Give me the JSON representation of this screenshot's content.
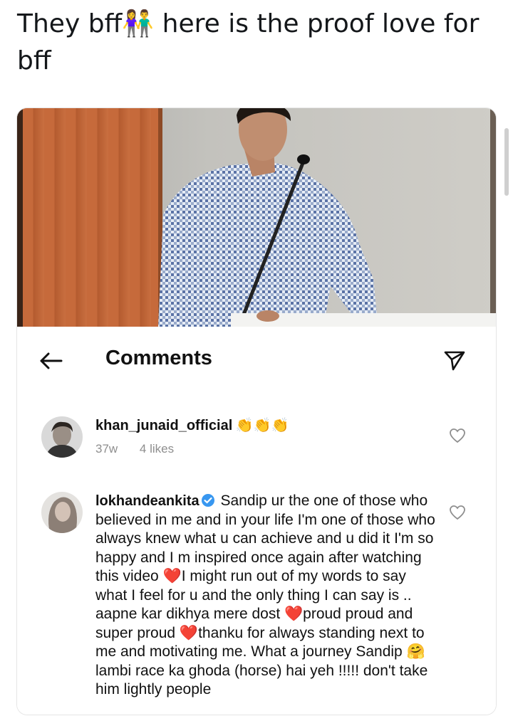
{
  "tweet": {
    "text_before": "They bff",
    "emoji": "👫",
    "text_after": " here is the proof love for bff"
  },
  "photo": {
    "description_colors": {
      "door": "#c66a3b",
      "wall": "#cfcdc7",
      "shirt": "#7d8fb3"
    }
  },
  "comments_header": {
    "title": "Comments",
    "back_icon": "arrow-left-icon",
    "share_icon": "paper-plane-icon"
  },
  "comments": [
    {
      "username": "khan_junaid_official",
      "emojis": "👏👏👏",
      "age": "37w",
      "likes": "4 likes",
      "icon": "heart-outline-icon"
    },
    {
      "username": "lokhandeankita",
      "verified": true,
      "text_1": "Sandip ur the one of those who believed in me and in your life I'm one of those who always knew what u can achieve and u did it I'm so happy and I m inspired once again after watching this video ",
      "heart_1": "❤️",
      "text_2": "I might run out of my words to say what I feel for u and the only thing I can say is .. aapne kar dikhya mere dost ",
      "heart_2": "❤️",
      "text_3": "proud proud and super proud ",
      "heart_3": "❤️",
      "text_4": "thanku for always standing next to me and motivating me. What a journey Sandip ",
      "emoji_hug": "🤗",
      "text_5": " lambi race ka ghoda (horse) hai yeh !!!!! don't take him lightly people",
      "icon": "heart-outline-icon"
    }
  ],
  "colors": {
    "meta_gray": "#8e8e8e",
    "verified_blue": "#3897f0",
    "heart_red": "#e0245e"
  }
}
